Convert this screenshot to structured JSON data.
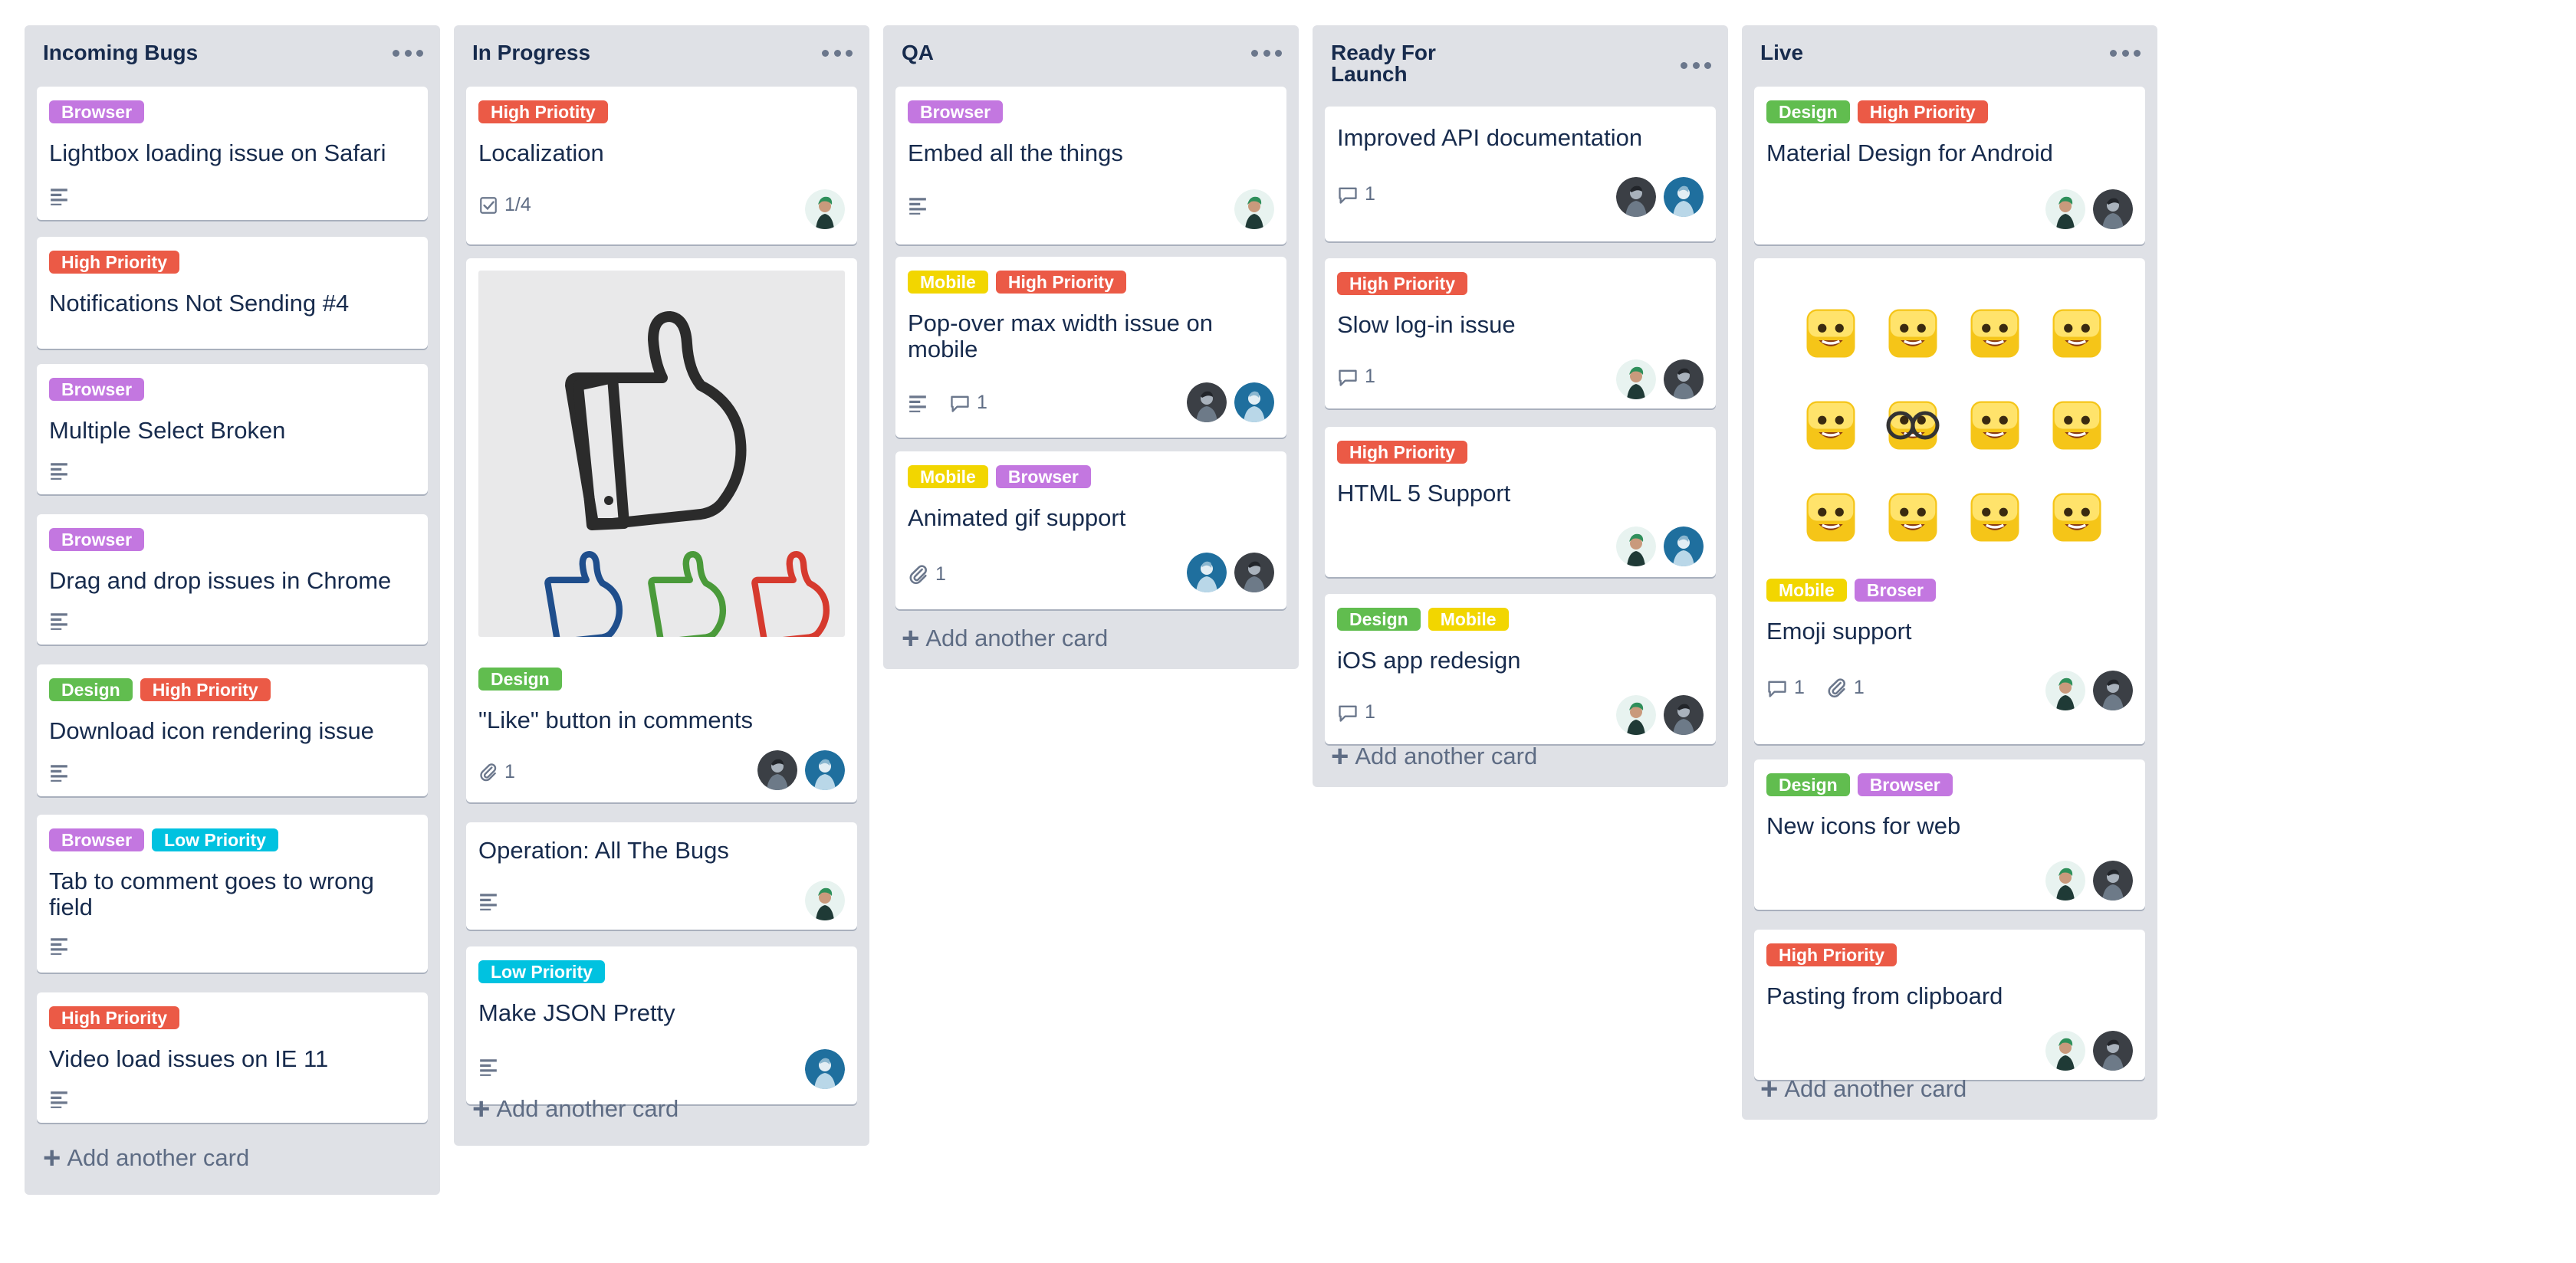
{
  "board": {
    "add_card_label": "Add another card",
    "lists": [
      {
        "title": "Incoming Bugs",
        "cards": [
          {
            "labels": [
              {
                "text": "Browser",
                "color": "#c377e0"
              }
            ],
            "title": "Lightbox loading issue on Safari",
            "badges": [
              "description"
            ]
          },
          {
            "labels": [
              {
                "text": "High Priority",
                "color": "#eb5a46"
              }
            ],
            "title": "Notifications Not Sending #4"
          },
          {
            "labels": [
              {
                "text": "Browser",
                "color": "#c377e0"
              }
            ],
            "title": "Multiple Select Broken",
            "badges": [
              "description"
            ]
          },
          {
            "labels": [
              {
                "text": "Browser",
                "color": "#c377e0"
              }
            ],
            "title": "Drag and drop issues in Chrome",
            "badges": [
              "description"
            ]
          },
          {
            "labels": [
              {
                "text": "Design",
                "color": "#61bd4f"
              },
              {
                "text": "High Priority",
                "color": "#eb5a46"
              }
            ],
            "title": "Download icon rendering issue",
            "badges": [
              "description"
            ]
          },
          {
            "labels": [
              {
                "text": "Browser",
                "color": "#c377e0"
              },
              {
                "text": "Low Priority",
                "color": "#00c2e0"
              }
            ],
            "title": "Tab to comment goes to wrong field",
            "badges": [
              "description"
            ]
          },
          {
            "labels": [
              {
                "text": "High Priority",
                "color": "#eb5a46"
              }
            ],
            "title": "Video load issues on IE 11",
            "badges": [
              "description"
            ]
          }
        ]
      },
      {
        "title": "In Progress",
        "cards": [
          {
            "labels": [
              {
                "text": "High Priotity",
                "color": "#eb5a46"
              }
            ],
            "title": "Localization",
            "checklist": "1/4",
            "avatars": [
              "green-hair"
            ]
          },
          {
            "cover": "thumbs-up-illustration",
            "labels": [
              {
                "text": "Design",
                "color": "#61bd4f"
              }
            ],
            "title": "\"Like\" button in comments",
            "attachments": "1",
            "avatars": [
              "dark",
              "blue"
            ]
          },
          {
            "title": "Operation: All The Bugs",
            "badges": [
              "description"
            ],
            "avatars": [
              "green-hair"
            ]
          },
          {
            "labels": [
              {
                "text": "Low Priority",
                "color": "#00c2e0"
              }
            ],
            "title": "Make JSON Pretty",
            "badges": [
              "description"
            ],
            "avatars": [
              "blue"
            ]
          }
        ]
      },
      {
        "title": "QA",
        "cards": [
          {
            "labels": [
              {
                "text": "Browser",
                "color": "#c377e0"
              }
            ],
            "title": "Embed all the things",
            "badges": [
              "description"
            ],
            "avatars": [
              "green-hair"
            ]
          },
          {
            "labels": [
              {
                "text": "Mobile",
                "color": "#f2d600"
              },
              {
                "text": "High Priority",
                "color": "#eb5a46"
              }
            ],
            "title": "Pop-over max width issue on mobile",
            "badges": [
              "description"
            ],
            "comments": "1",
            "avatars": [
              "dark",
              "blue"
            ]
          },
          {
            "labels": [
              {
                "text": "Mobile",
                "color": "#f2d600"
              },
              {
                "text": "Browser",
                "color": "#c377e0"
              }
            ],
            "title": "Animated gif support",
            "attachments": "1",
            "avatars": [
              "blue",
              "dark"
            ]
          }
        ]
      },
      {
        "title": "Ready For\nLaunch",
        "title_line1": "Ready For",
        "title_line2": "Launch",
        "cards": [
          {
            "title": "Improved API documentation",
            "comments": "1",
            "avatars": [
              "dark",
              "blue"
            ]
          },
          {
            "labels": [
              {
                "text": "High Priority",
                "color": "#eb5a46"
              }
            ],
            "title": "Slow log-in issue",
            "comments": "1",
            "avatars": [
              "green-hair",
              "dark"
            ]
          },
          {
            "labels": [
              {
                "text": "High Priority",
                "color": "#eb5a46"
              }
            ],
            "title": "HTML 5 Support",
            "avatars": [
              "green-hair",
              "blue"
            ]
          },
          {
            "labels": [
              {
                "text": "Design",
                "color": "#61bd4f"
              },
              {
                "text": "Mobile",
                "color": "#f2d600"
              }
            ],
            "title": "iOS app redesign",
            "comments": "1",
            "avatars": [
              "green-hair",
              "dark"
            ]
          }
        ]
      },
      {
        "title": "Live",
        "cards": [
          {
            "labels": [
              {
                "text": "Design",
                "color": "#61bd4f"
              },
              {
                "text": "High Priority",
                "color": "#eb5a46"
              }
            ],
            "title": "Material Design for Android",
            "avatars": [
              "green-hair",
              "dark"
            ]
          },
          {
            "cover": "emoji-grid",
            "labels": [
              {
                "text": "Mobile",
                "color": "#f2d600"
              },
              {
                "text": "Broser",
                "color": "#c377e0"
              }
            ],
            "title": "Emoji support",
            "comments": "1",
            "attachments": "1",
            "avatars": [
              "green-hair",
              "dark"
            ]
          },
          {
            "labels": [
              {
                "text": "Design",
                "color": "#61bd4f"
              },
              {
                "text": "Browser",
                "color": "#c377e0"
              }
            ],
            "title": "New icons for web",
            "avatars": [
              "green-hair",
              "dark"
            ]
          },
          {
            "labels": [
              {
                "text": "High Priority",
                "color": "#eb5a46"
              }
            ],
            "title": "Pasting from clipboard",
            "avatars": [
              "green-hair",
              "dark"
            ]
          }
        ]
      }
    ]
  }
}
